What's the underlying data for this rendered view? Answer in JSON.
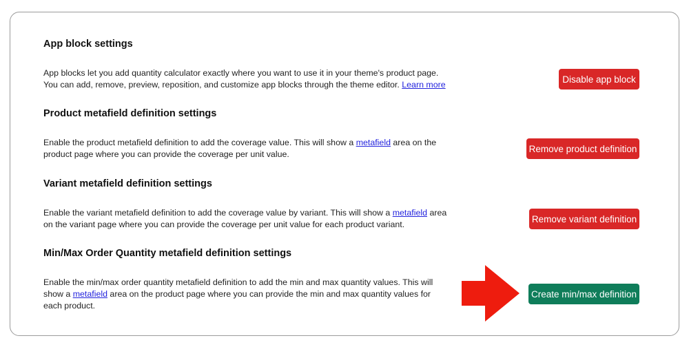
{
  "sections": [
    {
      "heading": "App block settings",
      "description_parts": [
        "App blocks let you add quantity calculator exactly where you want to use it in your theme's product page. You can add, remove, preview, reposition, and customize app blocks through the theme editor. ",
        "Learn more",
        ""
      ],
      "button": {
        "label": "Disable app block",
        "color": "#d92727"
      }
    },
    {
      "heading": "Product metafield definition settings",
      "description_parts": [
        "Enable the product metafield definition to add the coverage value. This will show a ",
        "metafield",
        " area on the product page where you can provide the coverage per unit value."
      ],
      "button": {
        "label": "Remove product definition",
        "color": "#d92727"
      }
    },
    {
      "heading": "Variant metafield definition settings",
      "description_parts": [
        "Enable the variant metafield definition to add the coverage value by variant. This will show a ",
        "metafield",
        " area on the variant page where you can provide the coverage per unit value for each product variant."
      ],
      "button": {
        "label": "Remove variant definition",
        "color": "#d92727"
      }
    },
    {
      "heading": "Min/Max Order Quantity metafield definition settings",
      "description_parts": [
        "Enable the min/max order quantity metafield definition to add the min and max quantity values. This will show a ",
        "metafield",
        " area on the product page where you can provide the min and max quantity values for each product."
      ],
      "button": {
        "label": "Create min/max definition",
        "color": "#0f7d5a"
      }
    }
  ],
  "annotation": {
    "icon": "arrow-right-icon",
    "color": "#ee1c0e"
  }
}
